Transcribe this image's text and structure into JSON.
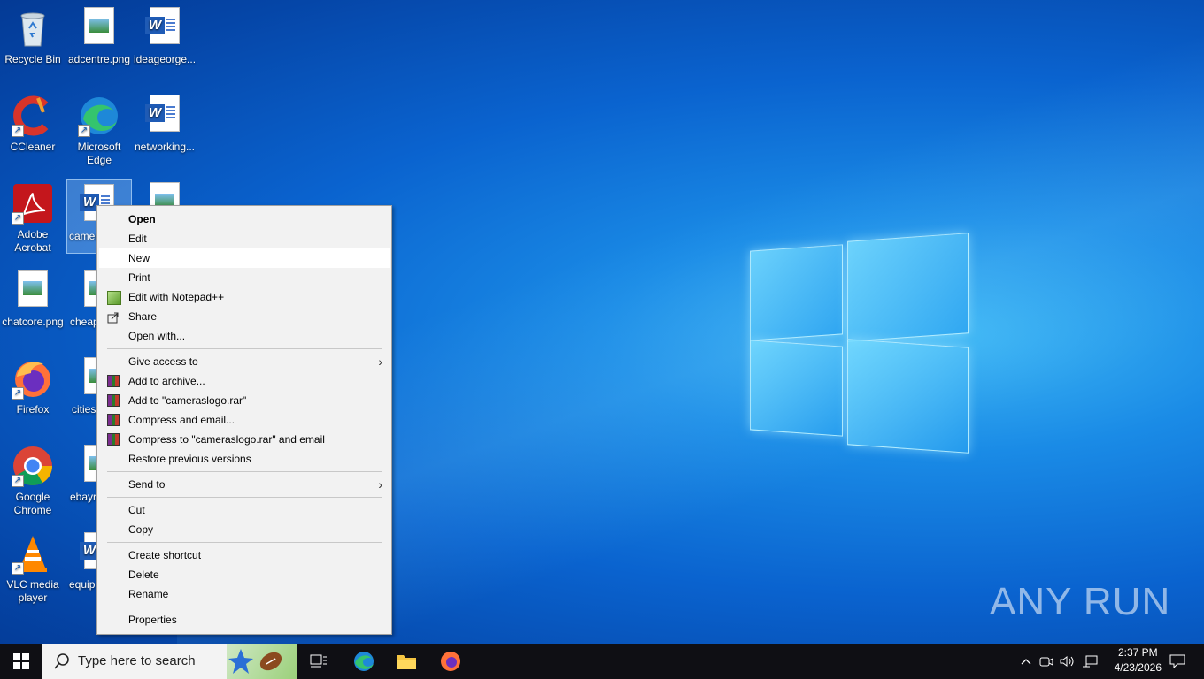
{
  "desktop_icons": [
    {
      "label": "Recycle Bin",
      "icon": "recycle-bin-icon"
    },
    {
      "label": "adcentre.png",
      "icon": "image-file-icon"
    },
    {
      "label": "ideageorge...",
      "icon": "word-doc-icon"
    },
    {
      "label": "CCleaner",
      "icon": "ccleaner-icon"
    },
    {
      "label": "Microsoft Edge",
      "icon": "edge-icon"
    },
    {
      "label": "networking...",
      "icon": "word-doc-icon"
    },
    {
      "label": "Adobe Acrobat",
      "icon": "acrobat-icon"
    },
    {
      "label": "camer",
      "icon": "word-doc-icon"
    },
    {
      "label": "chatcore.png",
      "icon": "image-file-icon"
    },
    {
      "label": "cheap",
      "icon": "image-file-icon"
    },
    {
      "label": "Firefox",
      "icon": "firefox-icon"
    },
    {
      "label": "cities",
      "icon": "image-file-icon"
    },
    {
      "label": "Google Chrome",
      "icon": "chrome-icon"
    },
    {
      "label": "ebayr",
      "icon": "image-file-icon"
    },
    {
      "label": "VLC media player",
      "icon": "vlc-icon"
    },
    {
      "label": "equip",
      "icon": "word-doc-icon"
    }
  ],
  "context_menu": {
    "items": [
      {
        "label": "Open"
      },
      {
        "label": "Edit"
      },
      {
        "label": "New"
      },
      {
        "label": "Print"
      },
      {
        "label": "Edit with Notepad++"
      },
      {
        "label": "Share"
      },
      {
        "label": "Open with..."
      },
      {
        "label": "Give access to"
      },
      {
        "label": "Add to archive..."
      },
      {
        "label": "Add to \"cameraslogo.rar\""
      },
      {
        "label": "Compress and email..."
      },
      {
        "label": "Compress to \"cameraslogo.rar\" and email"
      },
      {
        "label": "Restore previous versions"
      },
      {
        "label": "Send to"
      },
      {
        "label": "Cut"
      },
      {
        "label": "Copy"
      },
      {
        "label": "Create shortcut"
      },
      {
        "label": "Delete"
      },
      {
        "label": "Rename"
      },
      {
        "label": "Properties"
      }
    ]
  },
  "taskbar": {
    "search_placeholder": "Type here to search",
    "time": "2:37 PM",
    "date": "4/23/2026"
  },
  "watermark": "ANY RUN"
}
